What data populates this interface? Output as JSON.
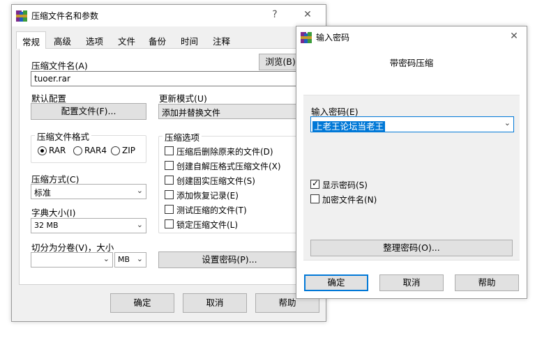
{
  "main_window": {
    "title": "压缩文件名和参数",
    "help_glyph": "?",
    "close_glyph": "✕",
    "tabs": [
      {
        "label": "常规"
      },
      {
        "label": "高级"
      },
      {
        "label": "选项"
      },
      {
        "label": "文件"
      },
      {
        "label": "备份"
      },
      {
        "label": "时间"
      },
      {
        "label": "注释"
      }
    ],
    "archive_name_label": "压缩文件名(A)",
    "archive_name_value": "tuoer.rar",
    "browse_label": "浏览(B)...",
    "default_profile_label": "默认配置",
    "profiles_button": "配置文件(F)...",
    "update_mode_label": "更新模式(U)",
    "update_mode_value": "添加并替换文件",
    "format_group_title": "压缩文件格式",
    "formats": [
      {
        "label": "RAR",
        "selected": true
      },
      {
        "label": "RAR4",
        "selected": false
      },
      {
        "label": "ZIP",
        "selected": false
      }
    ],
    "method_label": "压缩方式(C)",
    "method_value": "标准",
    "dict_label": "字典大小(I)",
    "dict_value": "32 MB",
    "split_label": "切分为分卷(V)，大小",
    "split_value": "",
    "split_unit": "MB",
    "options_group_title": "压缩选项",
    "options": [
      {
        "label": "压缩后删除原来的文件(D)",
        "checked": false
      },
      {
        "label": "创建自解压格式压缩文件(X)",
        "checked": false
      },
      {
        "label": "创建固实压缩文件(S)",
        "checked": false
      },
      {
        "label": "添加恢复记录(E)",
        "checked": false
      },
      {
        "label": "测试压缩的文件(T)",
        "checked": false
      },
      {
        "label": "锁定压缩文件(L)",
        "checked": false
      }
    ],
    "set_password_button": "设置密码(P)...",
    "ok": "确定",
    "cancel": "取消",
    "help": "帮助"
  },
  "password_dialog": {
    "title": "输入密码",
    "close_glyph": "✕",
    "heading": "带密码压缩",
    "password_label": "输入密码(E)",
    "password_value": "上老王论坛当老王",
    "show_password": {
      "label": "显示密码(S)",
      "checked": true
    },
    "encrypt_names": {
      "label": "加密文件名(N)",
      "checked": false
    },
    "organize_button": "整理密码(O)...",
    "ok": "确定",
    "cancel": "取消",
    "help": "帮助"
  },
  "icons": {
    "app": "winrar-icon",
    "dropdown": "chevron-down-icon",
    "checkmark": "checkmark-icon"
  },
  "colors": {
    "selection": "#0078d7",
    "button_face": "#e1e1e1",
    "panel": "#f0f0f0"
  }
}
